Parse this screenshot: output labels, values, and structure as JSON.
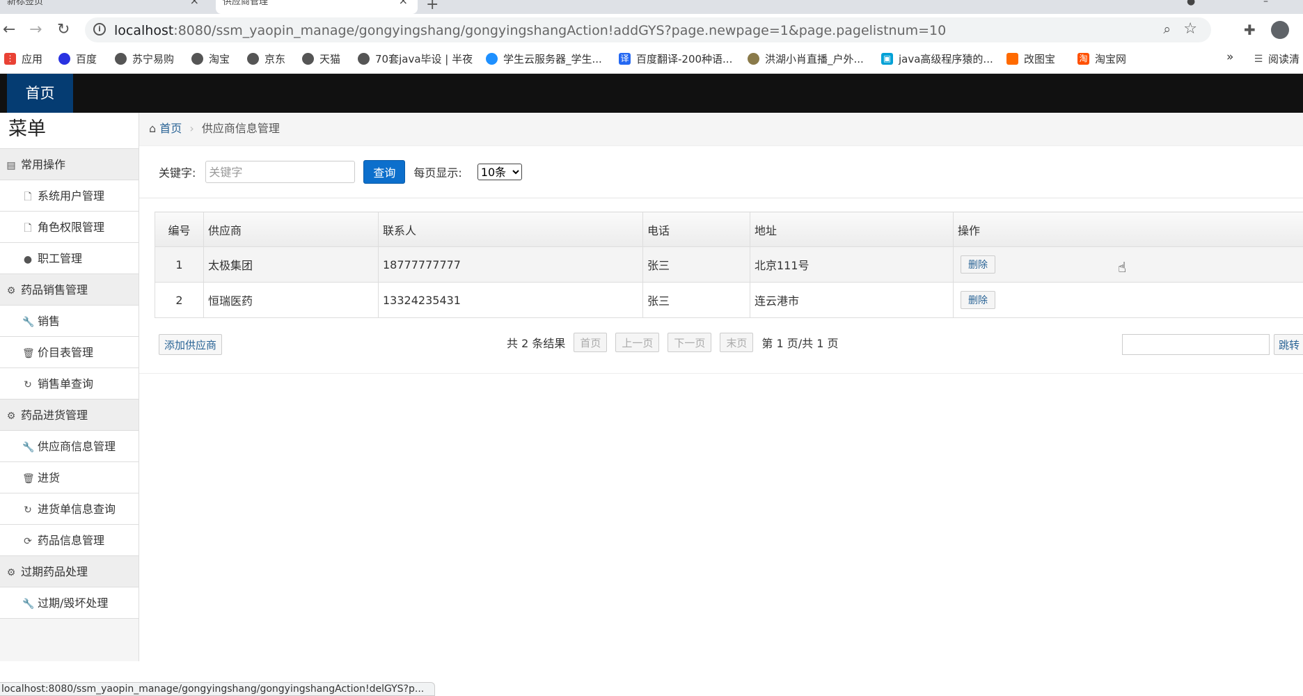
{
  "browser": {
    "tabs": [
      {
        "title": "新标签页"
      },
      {
        "title": "供应商管理"
      }
    ],
    "url_host": "localhost",
    "url_rest": ":8080/ssm_yaopin_manage/gongyingshang/gongyingshangAction!addGYS?page.newpage=1&page.pagelistnum=10",
    "bookmarks": [
      {
        "label": "应用",
        "color": "#e94235"
      },
      {
        "label": "百度",
        "color": "#2932e1"
      },
      {
        "label": "苏宁易购",
        "color": "#555555"
      },
      {
        "label": "淘宝",
        "color": "#555555"
      },
      {
        "label": "京东",
        "color": "#555555"
      },
      {
        "label": "天猫",
        "color": "#555555"
      },
      {
        "label": "70套java毕设 | 半夜",
        "color": "#555555"
      },
      {
        "label": "学生云服务器_学生...",
        "color": "#1e90ff"
      },
      {
        "label": "百度翻译-200种语...",
        "color": "#2468f2"
      },
      {
        "label": "洪湖小肖直播_户外...",
        "color": "#8a7a4a"
      },
      {
        "label": "java高级程序猿的...",
        "color": "#00a1d6"
      },
      {
        "label": "改图宝",
        "color": "#ff6a00"
      },
      {
        "label": "淘宝网",
        "color": "#ff5000"
      }
    ],
    "bookmarks_more": "»",
    "reading_list": "阅读清",
    "status_url": "localhost:8080/ssm_yaopin_manage/gongyingshang/gongyingshangAction!delGYS?p..."
  },
  "header": {
    "home_tab": "首页"
  },
  "sidebar": {
    "title": "菜单",
    "groups": [
      {
        "label": "常用操作",
        "items": [
          "系统用户管理",
          "角色权限管理",
          "职工管理"
        ]
      },
      {
        "label": "药品销售管理",
        "items": [
          "销售",
          "价目表管理",
          "销售单查询"
        ]
      },
      {
        "label": "药品进货管理",
        "items": [
          "供应商信息管理",
          "进货",
          "进货单信息查询",
          "药品信息管理"
        ]
      },
      {
        "label": "过期药品处理",
        "items": [
          "过期/毁坏处理"
        ]
      }
    ]
  },
  "breadcrumb": {
    "home": "首页",
    "current": "供应商信息管理"
  },
  "search": {
    "keyword_label": "关键字:",
    "keyword_placeholder": "关键字",
    "query_button": "查询",
    "per_page_label": "每页显示:",
    "per_page_value": "10条"
  },
  "table": {
    "headers": [
      "编号",
      "供应商",
      "联系人",
      "电话",
      "地址",
      "操作"
    ],
    "rows": [
      {
        "id": "1",
        "supplier": "太极集团",
        "contact": "18777777777",
        "phone": "张三",
        "address": "北京111号",
        "action": "删除"
      },
      {
        "id": "2",
        "supplier": "恒瑞医药",
        "contact": "13324235431",
        "phone": "张三",
        "address": "连云港市",
        "action": "删除"
      }
    ]
  },
  "footer": {
    "add_button": "添加供应商",
    "total": "共 2 条结果",
    "first": "首页",
    "prev": "上一页",
    "next": "下一页",
    "last": "末页",
    "page_info": "第 1 页/共 1 页",
    "jump_button": "跳转"
  }
}
